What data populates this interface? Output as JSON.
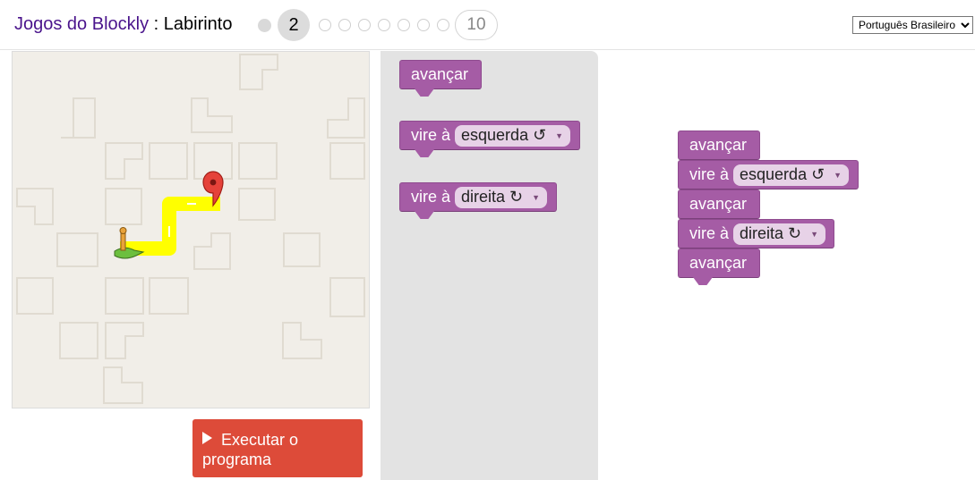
{
  "header": {
    "app_name": "Jogos do Blockly",
    "separator": " : ",
    "game_name": "Labirinto",
    "current_level": "2",
    "last_level": "10",
    "language": "Português Brasileiro"
  },
  "run_button": {
    "label_line1": "Executar o",
    "label_line2": "programa"
  },
  "toolbox": {
    "forward": "avançar",
    "turn_left": {
      "label": "vire à",
      "option": "esquerda ↺"
    },
    "turn_right": {
      "label": "vire à",
      "option": "direita ↻"
    }
  },
  "workspace": {
    "b1": "avançar",
    "b2": {
      "label": "vire à",
      "option": "esquerda ↺"
    },
    "b3": "avançar",
    "b4": {
      "label": "vire à",
      "option": "direita ↻"
    },
    "b5": "avançar"
  },
  "colors": {
    "block": "#a55ca5",
    "run_button": "#dd4b39",
    "path": "#ffff00",
    "title_accent": "#4a148c"
  },
  "icons": {
    "run": "play-icon",
    "start": "pegman-icon",
    "goal": "map-marker-icon"
  }
}
